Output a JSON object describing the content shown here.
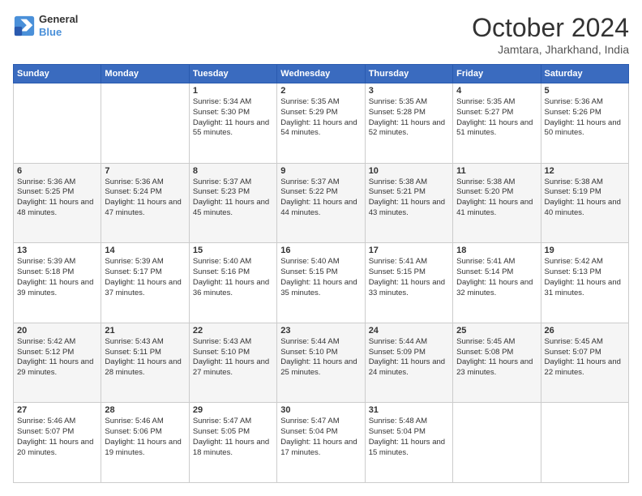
{
  "header": {
    "logo_line1": "General",
    "logo_line2": "Blue",
    "month_title": "October 2024",
    "location": "Jamtara, Jharkhand, India"
  },
  "days_of_week": [
    "Sunday",
    "Monday",
    "Tuesday",
    "Wednesday",
    "Thursday",
    "Friday",
    "Saturday"
  ],
  "weeks": [
    [
      {
        "day": "",
        "content": ""
      },
      {
        "day": "",
        "content": ""
      },
      {
        "day": "1",
        "sunrise": "Sunrise: 5:34 AM",
        "sunset": "Sunset: 5:30 PM",
        "daylight": "Daylight: 11 hours and 55 minutes."
      },
      {
        "day": "2",
        "sunrise": "Sunrise: 5:35 AM",
        "sunset": "Sunset: 5:29 PM",
        "daylight": "Daylight: 11 hours and 54 minutes."
      },
      {
        "day": "3",
        "sunrise": "Sunrise: 5:35 AM",
        "sunset": "Sunset: 5:28 PM",
        "daylight": "Daylight: 11 hours and 52 minutes."
      },
      {
        "day": "4",
        "sunrise": "Sunrise: 5:35 AM",
        "sunset": "Sunset: 5:27 PM",
        "daylight": "Daylight: 11 hours and 51 minutes."
      },
      {
        "day": "5",
        "sunrise": "Sunrise: 5:36 AM",
        "sunset": "Sunset: 5:26 PM",
        "daylight": "Daylight: 11 hours and 50 minutes."
      }
    ],
    [
      {
        "day": "6",
        "sunrise": "Sunrise: 5:36 AM",
        "sunset": "Sunset: 5:25 PM",
        "daylight": "Daylight: 11 hours and 48 minutes."
      },
      {
        "day": "7",
        "sunrise": "Sunrise: 5:36 AM",
        "sunset": "Sunset: 5:24 PM",
        "daylight": "Daylight: 11 hours and 47 minutes."
      },
      {
        "day": "8",
        "sunrise": "Sunrise: 5:37 AM",
        "sunset": "Sunset: 5:23 PM",
        "daylight": "Daylight: 11 hours and 45 minutes."
      },
      {
        "day": "9",
        "sunrise": "Sunrise: 5:37 AM",
        "sunset": "Sunset: 5:22 PM",
        "daylight": "Daylight: 11 hours and 44 minutes."
      },
      {
        "day": "10",
        "sunrise": "Sunrise: 5:38 AM",
        "sunset": "Sunset: 5:21 PM",
        "daylight": "Daylight: 11 hours and 43 minutes."
      },
      {
        "day": "11",
        "sunrise": "Sunrise: 5:38 AM",
        "sunset": "Sunset: 5:20 PM",
        "daylight": "Daylight: 11 hours and 41 minutes."
      },
      {
        "day": "12",
        "sunrise": "Sunrise: 5:38 AM",
        "sunset": "Sunset: 5:19 PM",
        "daylight": "Daylight: 11 hours and 40 minutes."
      }
    ],
    [
      {
        "day": "13",
        "sunrise": "Sunrise: 5:39 AM",
        "sunset": "Sunset: 5:18 PM",
        "daylight": "Daylight: 11 hours and 39 minutes."
      },
      {
        "day": "14",
        "sunrise": "Sunrise: 5:39 AM",
        "sunset": "Sunset: 5:17 PM",
        "daylight": "Daylight: 11 hours and 37 minutes."
      },
      {
        "day": "15",
        "sunrise": "Sunrise: 5:40 AM",
        "sunset": "Sunset: 5:16 PM",
        "daylight": "Daylight: 11 hours and 36 minutes."
      },
      {
        "day": "16",
        "sunrise": "Sunrise: 5:40 AM",
        "sunset": "Sunset: 5:15 PM",
        "daylight": "Daylight: 11 hours and 35 minutes."
      },
      {
        "day": "17",
        "sunrise": "Sunrise: 5:41 AM",
        "sunset": "Sunset: 5:15 PM",
        "daylight": "Daylight: 11 hours and 33 minutes."
      },
      {
        "day": "18",
        "sunrise": "Sunrise: 5:41 AM",
        "sunset": "Sunset: 5:14 PM",
        "daylight": "Daylight: 11 hours and 32 minutes."
      },
      {
        "day": "19",
        "sunrise": "Sunrise: 5:42 AM",
        "sunset": "Sunset: 5:13 PM",
        "daylight": "Daylight: 11 hours and 31 minutes."
      }
    ],
    [
      {
        "day": "20",
        "sunrise": "Sunrise: 5:42 AM",
        "sunset": "Sunset: 5:12 PM",
        "daylight": "Daylight: 11 hours and 29 minutes."
      },
      {
        "day": "21",
        "sunrise": "Sunrise: 5:43 AM",
        "sunset": "Sunset: 5:11 PM",
        "daylight": "Daylight: 11 hours and 28 minutes."
      },
      {
        "day": "22",
        "sunrise": "Sunrise: 5:43 AM",
        "sunset": "Sunset: 5:10 PM",
        "daylight": "Daylight: 11 hours and 27 minutes."
      },
      {
        "day": "23",
        "sunrise": "Sunrise: 5:44 AM",
        "sunset": "Sunset: 5:10 PM",
        "daylight": "Daylight: 11 hours and 25 minutes."
      },
      {
        "day": "24",
        "sunrise": "Sunrise: 5:44 AM",
        "sunset": "Sunset: 5:09 PM",
        "daylight": "Daylight: 11 hours and 24 minutes."
      },
      {
        "day": "25",
        "sunrise": "Sunrise: 5:45 AM",
        "sunset": "Sunset: 5:08 PM",
        "daylight": "Daylight: 11 hours and 23 minutes."
      },
      {
        "day": "26",
        "sunrise": "Sunrise: 5:45 AM",
        "sunset": "Sunset: 5:07 PM",
        "daylight": "Daylight: 11 hours and 22 minutes."
      }
    ],
    [
      {
        "day": "27",
        "sunrise": "Sunrise: 5:46 AM",
        "sunset": "Sunset: 5:07 PM",
        "daylight": "Daylight: 11 hours and 20 minutes."
      },
      {
        "day": "28",
        "sunrise": "Sunrise: 5:46 AM",
        "sunset": "Sunset: 5:06 PM",
        "daylight": "Daylight: 11 hours and 19 minutes."
      },
      {
        "day": "29",
        "sunrise": "Sunrise: 5:47 AM",
        "sunset": "Sunset: 5:05 PM",
        "daylight": "Daylight: 11 hours and 18 minutes."
      },
      {
        "day": "30",
        "sunrise": "Sunrise: 5:47 AM",
        "sunset": "Sunset: 5:04 PM",
        "daylight": "Daylight: 11 hours and 17 minutes."
      },
      {
        "day": "31",
        "sunrise": "Sunrise: 5:48 AM",
        "sunset": "Sunset: 5:04 PM",
        "daylight": "Daylight: 11 hours and 15 minutes."
      },
      {
        "day": "",
        "content": ""
      },
      {
        "day": "",
        "content": ""
      }
    ]
  ]
}
